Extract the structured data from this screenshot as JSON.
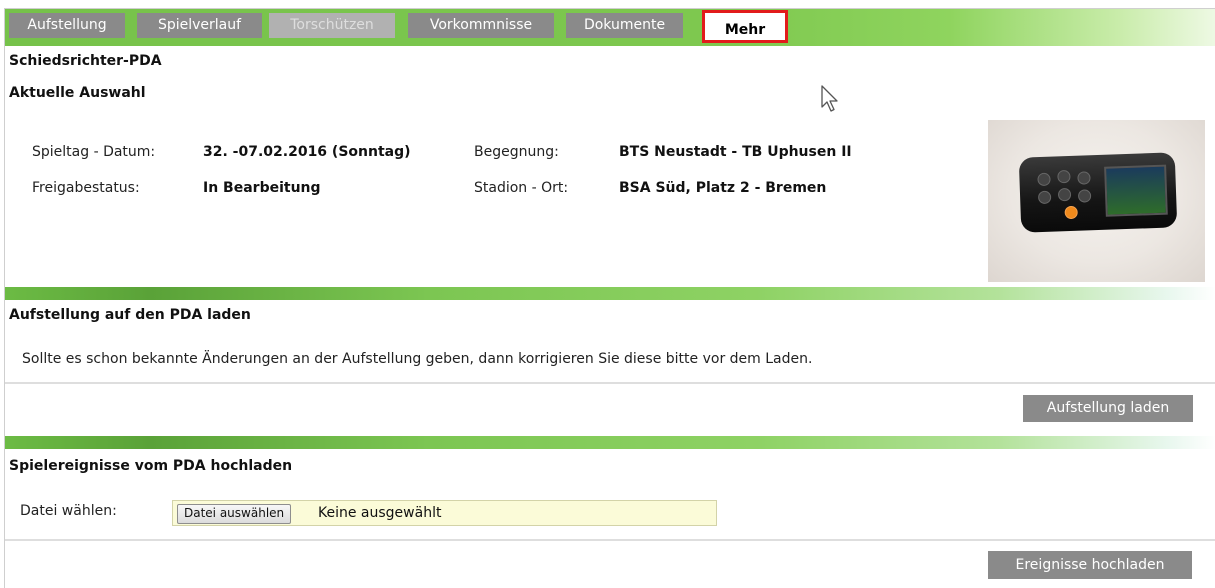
{
  "tabs": [
    {
      "label": "Aufstellung",
      "state": "normal"
    },
    {
      "label": "Spielverlauf",
      "state": "normal"
    },
    {
      "label": "Torschützen",
      "state": "disabled"
    },
    {
      "label": "Vorkommnisse",
      "state": "normal"
    },
    {
      "label": "Dokumente",
      "state": "normal"
    },
    {
      "label": "Mehr",
      "state": "active"
    }
  ],
  "page_title": "Schiedsrichter-PDA",
  "current_selection": {
    "heading": "Aktuelle Auswahl",
    "matchday_label": "Spieltag - Datum:",
    "matchday_value": "32. -07.02.2016 (Sonntag)",
    "fixture_label": "Begegnung:",
    "fixture_value": "BTS Neustadt - TB Uphusen II",
    "release_label": "Freigabestatus:",
    "release_value": "In Bearbeitung",
    "venue_label": "Stadion - Ort:",
    "venue_value": "BSA Süd, Platz 2 - Bremen"
  },
  "lineup_section": {
    "heading": "Aufstellung auf den PDA laden",
    "text": "Sollte es schon bekannte Änderungen an der Aufstellung geben, dann korrigieren Sie diese bitte vor dem Laden.",
    "button": "Aufstellung laden"
  },
  "upload_section": {
    "heading": "Spielereignisse vom PDA hochladen",
    "file_label": "Datei wählen:",
    "file_button": "Datei auswählen",
    "file_status": "Keine ausgewählt",
    "button": "Ereignisse hochladen"
  },
  "colors": {
    "accent_green": "#7ec84f",
    "tab_gray": "#8a8a8a",
    "highlight_red": "#e21b1b",
    "file_input_bg": "#fbfbd8"
  },
  "icons": {
    "cursor": "mouse-pointer-icon",
    "device": "pda-device-image"
  }
}
